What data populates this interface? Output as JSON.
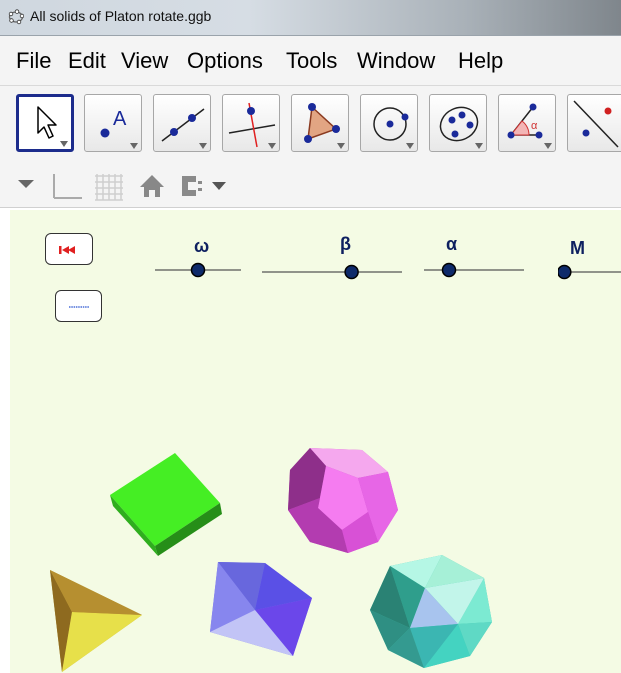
{
  "window": {
    "title": "All solids of Platon rotate.ggb"
  },
  "menu": {
    "items": [
      "File",
      "Edit",
      "View",
      "Options",
      "Tools",
      "Window",
      "Help"
    ]
  },
  "toolbar": {
    "tool_icons": [
      "move-tool-icon",
      "point-tool-icon",
      "line-tool-icon",
      "perpendicular-line-tool-icon",
      "polygon-tool-icon",
      "circle-tool-icon",
      "conic-tool-icon",
      "angle-tool-icon",
      "reflect-tool-icon"
    ],
    "selected": 0
  },
  "sliders": {
    "omega": {
      "label": "ω",
      "value": 0.5
    },
    "beta": {
      "label": "β",
      "value": 0.64
    },
    "alpha": {
      "label": "α",
      "value": 0.25
    },
    "m": {
      "label": "M",
      "value": 0.1
    }
  },
  "colors": {
    "graphics_bg": "#f4fbe4",
    "selected_tool_border": "#1c2c8c",
    "slider_label": "#0e2060",
    "cube": "#44ee22",
    "dodecahedron": "#ee66ee",
    "tetrahedron": "#c8b028",
    "octahedron": "#7777ee",
    "icosahedron": "#44d4bb"
  }
}
